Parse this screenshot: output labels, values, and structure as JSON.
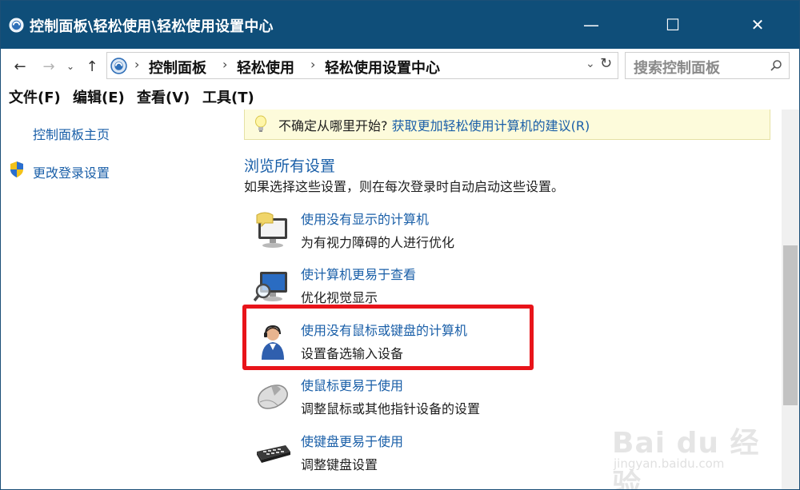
{
  "window": {
    "title": "控制面板\\轻松使用\\轻松使用设置中心",
    "minimize_glyph": "—",
    "maximize_glyph": "☐",
    "close_glyph": "✕"
  },
  "nav": {
    "back_glyph": "←",
    "forward_glyph": "→",
    "recent_glyph": "⌄",
    "up_glyph": "↑",
    "breadcrumb": [
      "控制面板",
      "轻松使用",
      "轻松使用设置中心"
    ],
    "separator": "›",
    "dropdown_glyph": "⌄",
    "refresh_glyph": "↻",
    "search_placeholder": "搜索控制面板"
  },
  "menu": [
    "文件(F)",
    "编辑(E)",
    "查看(V)",
    "工具(T)"
  ],
  "left_pane": {
    "home_link": "控制面板主页",
    "login_settings_link": "更改登录设置"
  },
  "tip": {
    "prefix": "不确定从哪里开始?",
    "link": " 获取更加轻松使用计算机的建议(R)"
  },
  "section": {
    "title": "浏览所有设置",
    "description": "如果选择这些设置，则在每次登录时自动启动这些设置。"
  },
  "items": [
    {
      "title": "使用没有显示的计算机",
      "desc": "为有视力障碍的人进行优化",
      "icon": "monitor-speech-icon"
    },
    {
      "title": "使计算机更易于查看",
      "desc": "优化视觉显示",
      "icon": "monitor-magnifier-icon"
    },
    {
      "title": "使用没有鼠标或键盘的计算机",
      "desc": "设置备选输入设备",
      "icon": "user-headset-icon"
    },
    {
      "title": "使鼠标更易于使用",
      "desc": "调整鼠标或其他指针设备的设置",
      "icon": "mouse-icon"
    },
    {
      "title": "使键盘更易于使用",
      "desc": "调整键盘设置",
      "icon": "keyboard-icon"
    }
  ],
  "watermark": {
    "brand": "Bai du 经验",
    "url": "jingyan.baidu.com"
  },
  "colors": {
    "titlebar": "#0f4e79",
    "link": "#1a5fa8",
    "highlight": "#e8141a",
    "tip_bg": "#fdfbdb"
  }
}
